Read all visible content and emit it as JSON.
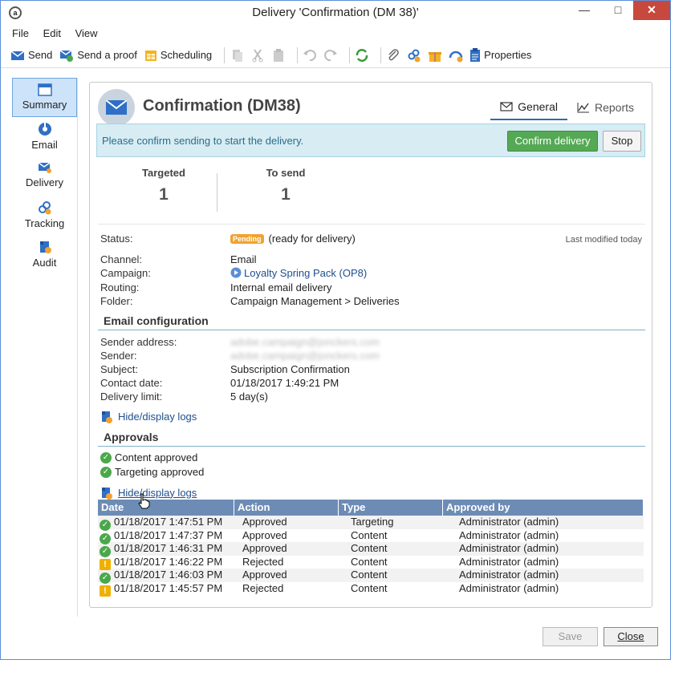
{
  "window": {
    "title": "Delivery 'Confirmation (DM 38)'",
    "minimize": "—",
    "maximize": "□",
    "close": "✕"
  },
  "menu": [
    "File",
    "Edit",
    "View"
  ],
  "toolbar": {
    "send": "Send",
    "send_proof": "Send a proof",
    "scheduling": "Scheduling",
    "properties": "Properties"
  },
  "sidebar": [
    {
      "label": "Summary",
      "icon": "summary-icon"
    },
    {
      "label": "Email",
      "icon": "email-icon"
    },
    {
      "label": "Delivery",
      "icon": "delivery-icon"
    },
    {
      "label": "Tracking",
      "icon": "tracking-icon"
    },
    {
      "label": "Audit",
      "icon": "audit-icon"
    }
  ],
  "header": {
    "title": "Confirmation (DM38)",
    "tab_general": "General",
    "tab_reports": "Reports"
  },
  "banner": {
    "message": "Please confirm sending to start the delivery.",
    "confirm": "Confirm delivery",
    "stop": "Stop"
  },
  "stats": {
    "targeted_label": "Targeted",
    "targeted_value": "1",
    "tosend_label": "To send",
    "tosend_value": "1"
  },
  "status": {
    "label": "Status:",
    "badge": "Pending",
    "text": "(ready for delivery)",
    "last_modified": "Last modified today"
  },
  "details": {
    "channel_label": "Channel:",
    "channel": "Email",
    "campaign_label": "Campaign:",
    "campaign": "Loyalty Spring Pack (OP8)",
    "routing_label": "Routing:",
    "routing": "Internal email delivery",
    "folder_label": "Folder:",
    "folder": "Campaign Management > Deliveries"
  },
  "email_config": {
    "heading": "Email configuration",
    "sender_address_label": "Sender address:",
    "sender_address": "adobe.campaign@jonckers.com",
    "sender_label": "Sender:",
    "sender": "adobe.campaign@jonckers.com",
    "subject_label": "Subject:",
    "subject": "Subscription Confirmation",
    "contact_date_label": "Contact date:",
    "contact_date": "01/18/2017 1:49:21 PM",
    "delivery_limit_label": "Delivery limit:",
    "delivery_limit": "5 day(s)",
    "logs_link": "Hide/display logs"
  },
  "approvals": {
    "heading": "Approvals",
    "content": "Content approved",
    "targeting": "Targeting approved",
    "logs_link": "Hide/display logs",
    "columns": [
      "Date",
      "Action",
      "Type",
      "Approved by"
    ],
    "rows": [
      {
        "status": "ok",
        "date": "01/18/2017 1:47:51 PM",
        "action": "Approved",
        "type": "Targeting",
        "by": "Administrator (admin)"
      },
      {
        "status": "ok",
        "date": "01/18/2017 1:47:37 PM",
        "action": "Approved",
        "type": "Content",
        "by": "Administrator (admin)"
      },
      {
        "status": "ok",
        "date": "01/18/2017 1:46:31 PM",
        "action": "Approved",
        "type": "Content",
        "by": "Administrator (admin)"
      },
      {
        "status": "warn",
        "date": "01/18/2017 1:46:22 PM",
        "action": "Rejected",
        "type": "Content",
        "by": "Administrator (admin)"
      },
      {
        "status": "ok",
        "date": "01/18/2017 1:46:03 PM",
        "action": "Approved",
        "type": "Content",
        "by": "Administrator (admin)"
      },
      {
        "status": "warn",
        "date": "01/18/2017 1:45:57 PM",
        "action": "Rejected",
        "type": "Content",
        "by": "Administrator (admin)"
      }
    ]
  },
  "footer": {
    "save": "Save",
    "close": "Close"
  },
  "colors": {
    "accent": "#2b6cb0",
    "confirm": "#55a955",
    "banner": "#d7ecf3",
    "pending": "#f0a32f",
    "table_header": "#6d8cb5"
  }
}
